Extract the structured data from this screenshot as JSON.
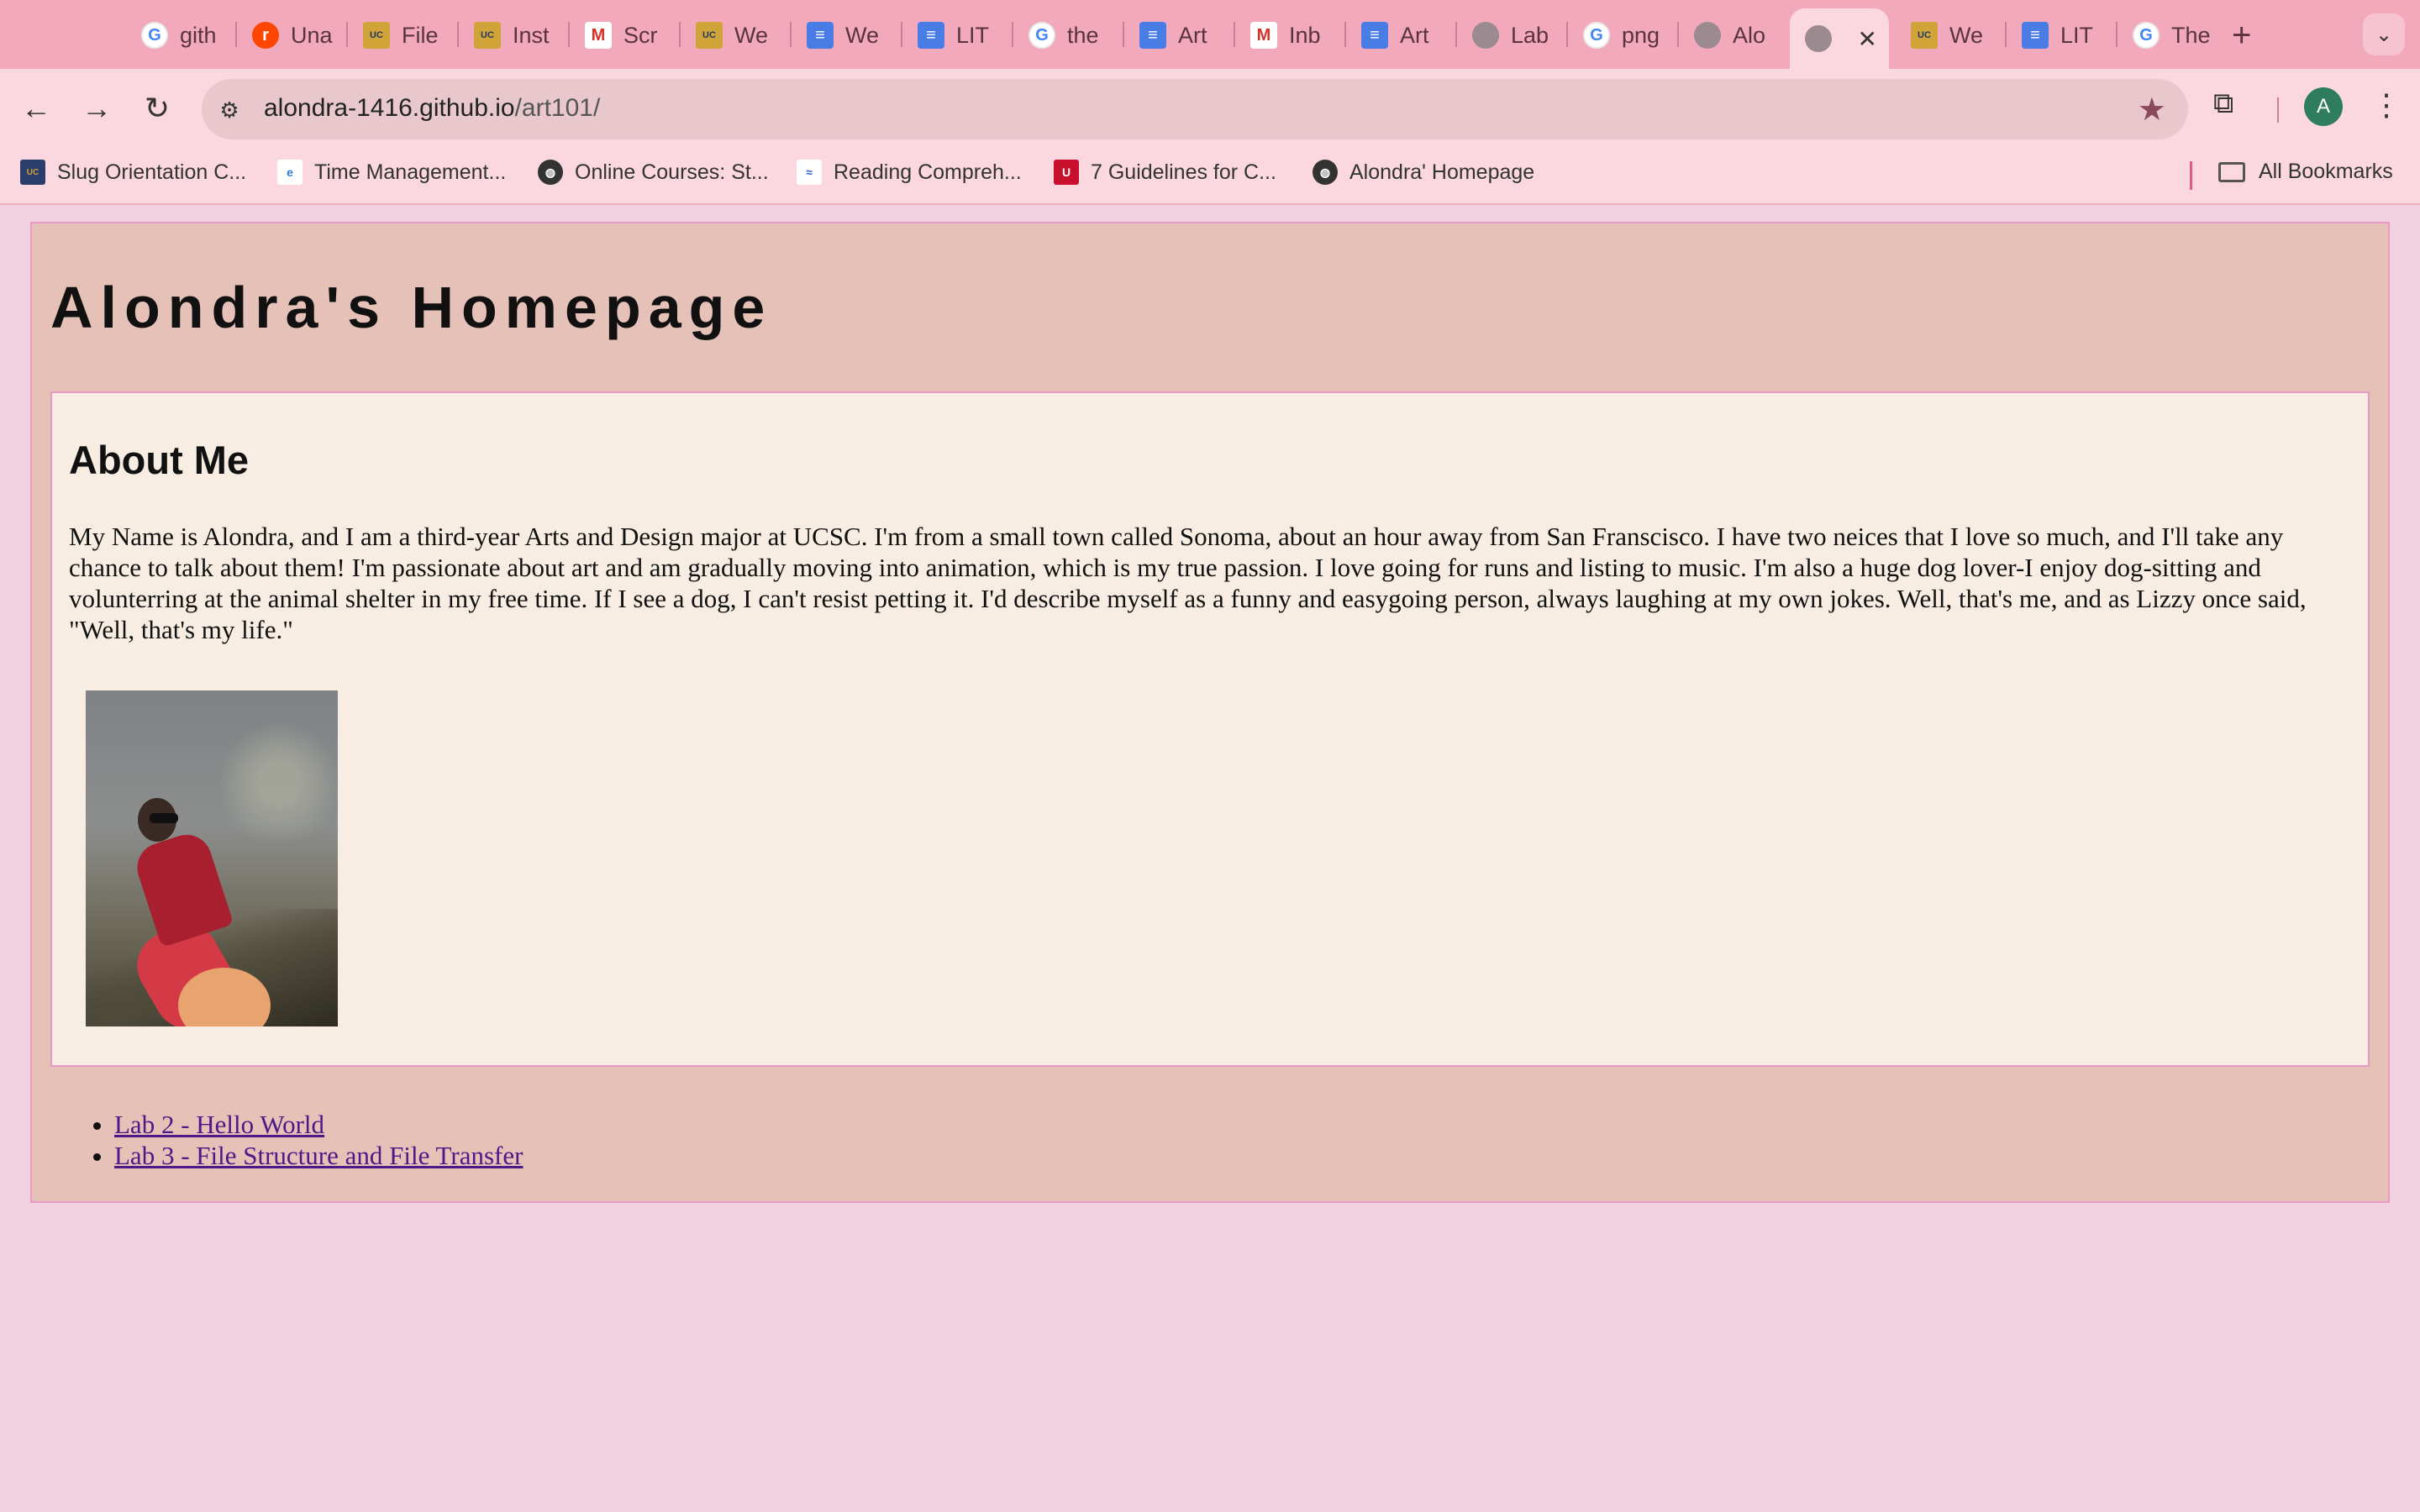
{
  "browser": {
    "tabs": [
      {
        "label": "gith",
        "icon": "google-icon"
      },
      {
        "label": "Una",
        "icon": "reddit-icon"
      },
      {
        "label": "File",
        "icon": "ucsc-icon"
      },
      {
        "label": "Inst",
        "icon": "ucsc-icon"
      },
      {
        "label": "Scr",
        "icon": "gmail-icon"
      },
      {
        "label": "We",
        "icon": "ucsc-icon"
      },
      {
        "label": "We",
        "icon": "docs-icon"
      },
      {
        "label": "LIT",
        "icon": "docs-icon"
      },
      {
        "label": "the",
        "icon": "google-icon"
      },
      {
        "label": "Art",
        "icon": "docs-icon"
      },
      {
        "label": "Inb",
        "icon": "gmail-icon"
      },
      {
        "label": "Art",
        "icon": "docs-icon"
      },
      {
        "label": "Lab",
        "icon": "web-icon"
      },
      {
        "label": "png",
        "icon": "google-icon"
      },
      {
        "label": "Alo",
        "icon": "web-icon"
      },
      {
        "label": "",
        "icon": "web-icon",
        "active": true
      },
      {
        "label": "We",
        "icon": "ucsc-icon"
      },
      {
        "label": "LIT",
        "icon": "docs-icon"
      },
      {
        "label": "The",
        "icon": "google-icon"
      }
    ],
    "close_glyph": "✕",
    "new_tab_glyph": "+",
    "url_host": "alondra-1416.github.io",
    "url_path": "/art101/",
    "profile_initial": "A",
    "bookmarks": [
      {
        "label": "Slug Orientation C...",
        "icon": "ucsc-icon"
      },
      {
        "label": "Time Management...",
        "icon": "tm-icon"
      },
      {
        "label": "Online Courses: St...",
        "icon": "globe-icon"
      },
      {
        "label": "Reading Compreh...",
        "icon": "reading-icon"
      },
      {
        "label": "7 Guidelines for C...",
        "icon": "usn-icon"
      },
      {
        "label": "Alondra' Homepage",
        "icon": "globe-icon"
      }
    ],
    "all_bookmarks_label": "All Bookmarks"
  },
  "page": {
    "title": "Alondra's Homepage",
    "about_heading": "About Me",
    "bio": "My Name is Alondra, and I am a third-year Arts and Design major at UCSC. I'm from a small town called Sonoma, about an hour away from San Franscisco. I have two neices that I love so much, and I'll take any chance to talk about them! I'm passionate about art and am gradually moving into animation, which is my true passion. I love going for runs and listing to music. I'm also a huge dog lover-I enjoy dog-sitting and volunterring at the animal shelter in my free time. If I see a dog, I can't resist petting it. I'd describe myself as a funny and easygoing person, always laughing at my own jokes. Well, that's me, and as Lizzy once said, \"Well, that's my life.\"",
    "links": [
      {
        "label": "Lab 2 - Hello World"
      },
      {
        "label": "Lab 3 - File Structure and File Transfer"
      }
    ]
  },
  "colors": {
    "tab_strip": "#f2a9bc",
    "toolbar": "#fbd7df",
    "page_bg": "#f1d1e0",
    "card_bg": "#e5c1b8",
    "inner_bg": "#f7ede3",
    "border": "#e69cc2",
    "link": "#4b1a86"
  }
}
